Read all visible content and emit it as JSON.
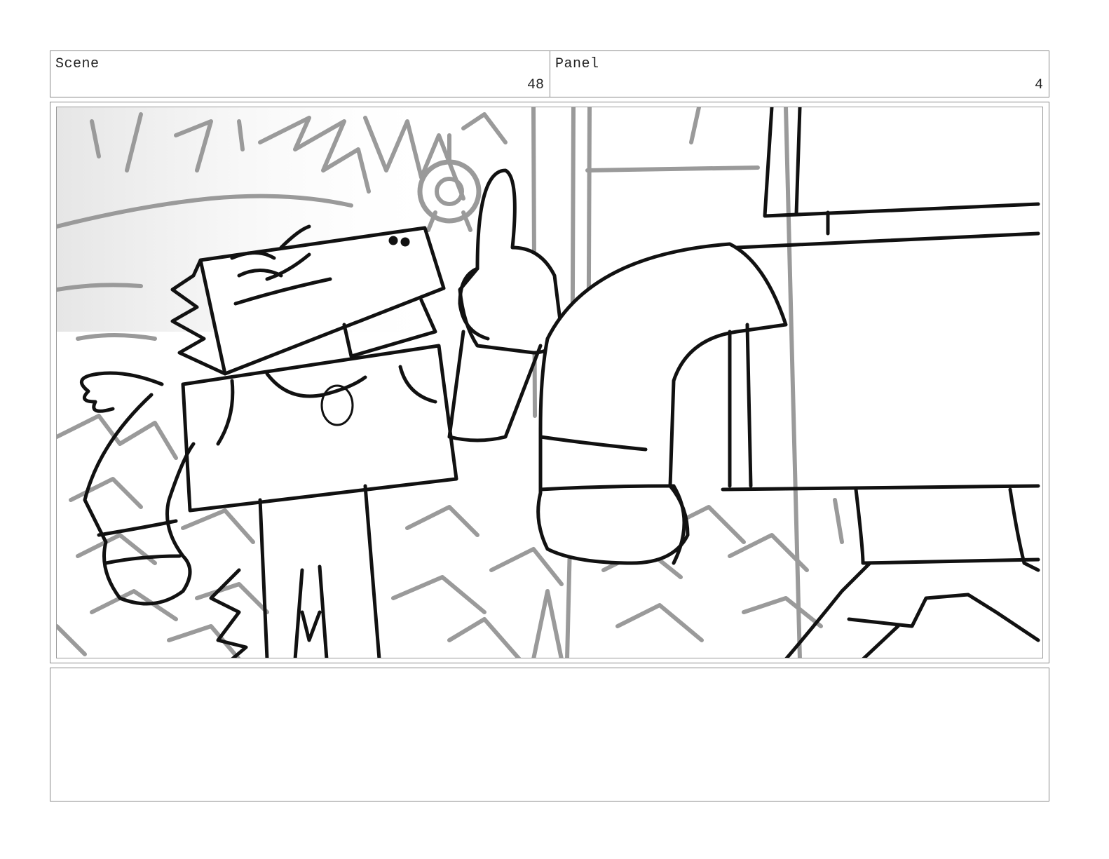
{
  "header": {
    "scene_label": "Scene",
    "scene_value": "48",
    "panel_label": "Panel",
    "panel_value": "4"
  },
  "notes": {
    "text": ""
  }
}
